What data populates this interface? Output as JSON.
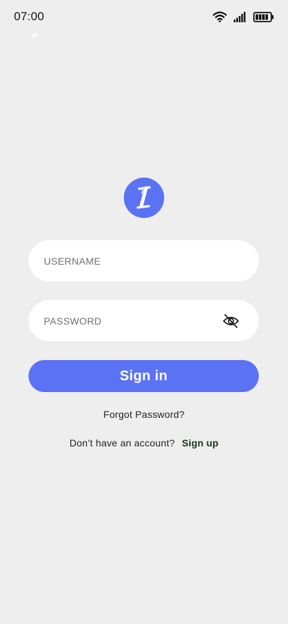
{
  "status_bar": {
    "time": "07:00",
    "icons": [
      "wifi-icon",
      "cellular-signal-icon",
      "battery-icon"
    ]
  },
  "logo": {
    "icon": "app-logo-icon",
    "color": "#5b72f5"
  },
  "login_form": {
    "username_placeholder": "USERNAME",
    "username_value": "",
    "password_placeholder": "PASSWORD",
    "password_value": "",
    "password_toggle_icon": "eye-off-icon",
    "sign_in_label": "Sign in",
    "forgot_password_label": "Forgot Password?",
    "no_account_text": "Don’t have an account?",
    "sign_up_label": "Sign up"
  },
  "colors": {
    "background": "#eeeeee",
    "accent": "#5b72f5",
    "field_background": "#ffffff",
    "sign_up_text": "#14361e"
  }
}
